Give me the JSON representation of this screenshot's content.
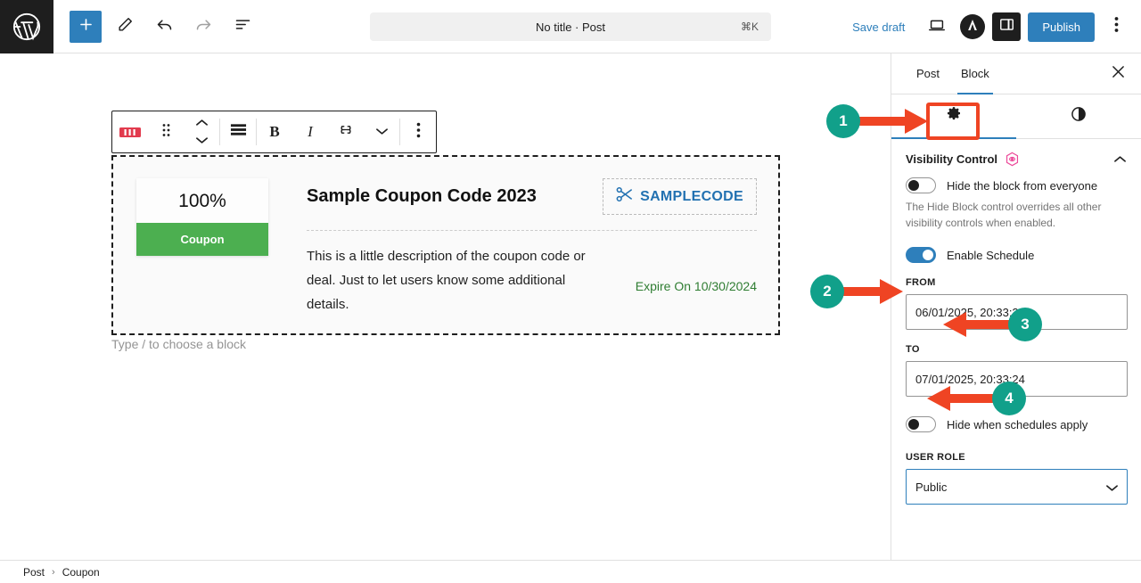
{
  "topbar": {
    "logo_icon": "wordpress-logo",
    "add_block_icon": "plus-icon",
    "edit_tool_icon": "pencil-icon",
    "undo_icon": "undo-arrow-icon",
    "redo_icon": "redo-arrow-icon",
    "list_view_icon": "list-view-icon",
    "document_title": "No title · Post",
    "document_shortcut": "⌘K",
    "save_draft_label": "Save draft",
    "preview_icon": "laptop-preview-icon",
    "avatar_icon": "astra-avatar-icon",
    "sidebar_toggle_icon": "settings-panel-icon",
    "publish_label": "Publish",
    "options_icon": "three-dots-vertical-icon"
  },
  "block_toolbar": {
    "block_type_icon": "coupon-block-icon",
    "drag_handle_icon": "drag-dots-icon",
    "move_up_icon": "chevron-up-icon",
    "move_down_icon": "chevron-down-icon",
    "align_icon": "align-center-icon",
    "bold_label": "B",
    "italic_label": "I",
    "link_icon": "link-icon",
    "more_formats_icon": "chevron-down-icon",
    "options_icon": "three-dots-vertical-icon"
  },
  "coupon_block": {
    "discount": "100%",
    "tag_label": "Coupon",
    "title": "Sample Coupon Code 2023",
    "code": "SAMPLECODE",
    "code_icon": "scissors-icon",
    "description": "This is a little description of the coupon code or deal. Just to let users know some additional details.",
    "expire": "Expire On 10/30/2024",
    "tag_color": "#4caf50",
    "code_color": "#2271b1",
    "expire_color": "#2f7d32"
  },
  "canvas": {
    "type_hint": "Type / to choose a block"
  },
  "sidebar": {
    "tabs": [
      {
        "label": "Post",
        "active": false
      },
      {
        "label": "Block",
        "active": true
      }
    ],
    "close_icon": "close-x-icon",
    "icon_tabs": [
      {
        "icon": "gear-settings-icon",
        "active": true
      },
      {
        "icon": "styles-contrast-icon",
        "active": false
      }
    ],
    "panel": {
      "title": "Visibility Control",
      "badge_icon": "visibility-eye-hexagon-icon",
      "collapse_icon": "chevron-up-icon"
    },
    "hide_block": {
      "label": "Hide the block from everyone",
      "enabled": false,
      "help": "The Hide Block control overrides all other visibility controls when enabled."
    },
    "enable_schedule": {
      "label": "Enable Schedule",
      "enabled": true
    },
    "from": {
      "label": "FROM",
      "value": "06/01/2025, 20:33:24"
    },
    "to": {
      "label": "TO",
      "value": "07/01/2025, 20:33:24"
    },
    "hide_when_schedules": {
      "label": "Hide when schedules apply",
      "enabled": false
    },
    "user_role": {
      "label": "USER ROLE",
      "value": "Public",
      "chevron_icon": "chevron-down-icon"
    }
  },
  "annotations": {
    "accent_color": "#ef4423",
    "badge_color": "#11a08a",
    "steps": [
      {
        "number": "1"
      },
      {
        "number": "2"
      },
      {
        "number": "3"
      },
      {
        "number": "4"
      }
    ]
  },
  "footer": {
    "breadcrumb": [
      "Post",
      "Coupon"
    ],
    "separator": "›"
  }
}
